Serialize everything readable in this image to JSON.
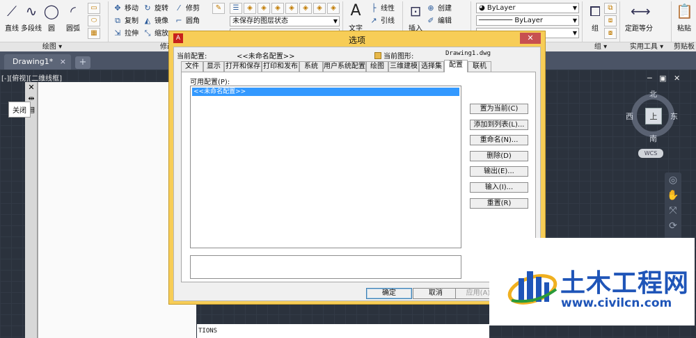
{
  "ribbon": {
    "draw_tools": [
      {
        "label": "直线",
        "icon": "line-icon"
      },
      {
        "label": "多段线",
        "icon": "polyline-icon"
      },
      {
        "label": "圆",
        "icon": "circle-icon"
      },
      {
        "label": "圆弧",
        "icon": "arc-icon"
      }
    ],
    "modify_tools": {
      "move": "移动",
      "rotate": "旋转",
      "trim": "修剪",
      "copy": "复制",
      "mirror": "镜像",
      "fillet": "圆角",
      "stretch": "拉伸",
      "scale": "缩放"
    },
    "layer_state": "未保存的图层状态",
    "annotation": {
      "text": "文字",
      "linear": "线性",
      "leader": "引线"
    },
    "block": {
      "insert": "插入",
      "create": "创建",
      "edit": "编辑"
    },
    "properties": {
      "color": "ByLayer",
      "linetype": "ByLayer"
    },
    "group_label": "组",
    "utility": {
      "measure": "定距等分"
    },
    "clipboard": {
      "paste": "粘贴"
    },
    "panel_titles": {
      "draw": "绘图",
      "modify": "修改",
      "group": "组",
      "utilities": "实用工具",
      "clipboard": "剪贴板"
    }
  },
  "file_tabs": [
    {
      "label": "Drawing1*"
    }
  ],
  "viewport": {
    "label": "[-][俯视][二维线框]",
    "tooltip": "关闭",
    "command_text": "TIONS",
    "viewcube": {
      "top": "上",
      "north": "北",
      "south": "南",
      "east": "东",
      "west": "西"
    },
    "wcs": "WCS"
  },
  "dialog": {
    "title": "选项",
    "current_profile_label": "当前配置:",
    "current_profile_value": "<<未命名配置>>",
    "current_drawing_label": "当前图形:",
    "current_drawing_value": "Drawing1.dwg",
    "tabs": [
      "文件",
      "显示",
      "打开和保存",
      "打印和发布",
      "系统",
      "用户系统配置",
      "绘图",
      "三维建模",
      "选择集",
      "配置",
      "联机"
    ],
    "active_tab": "配置",
    "available_profiles_label": "可用配置(P):",
    "profiles": [
      "<<未命名配置>>"
    ],
    "buttons": [
      "置为当前(C)",
      "添加到列表(L)...",
      "重命名(N)...",
      "删除(D)",
      "输出(E)...",
      "输入(I)...",
      "重置(R)"
    ],
    "footer": {
      "ok": "确定",
      "cancel": "取消",
      "apply": "应用(A)"
    }
  },
  "watermark": {
    "name": "土木工程网",
    "url": "www.civilcn.com"
  }
}
